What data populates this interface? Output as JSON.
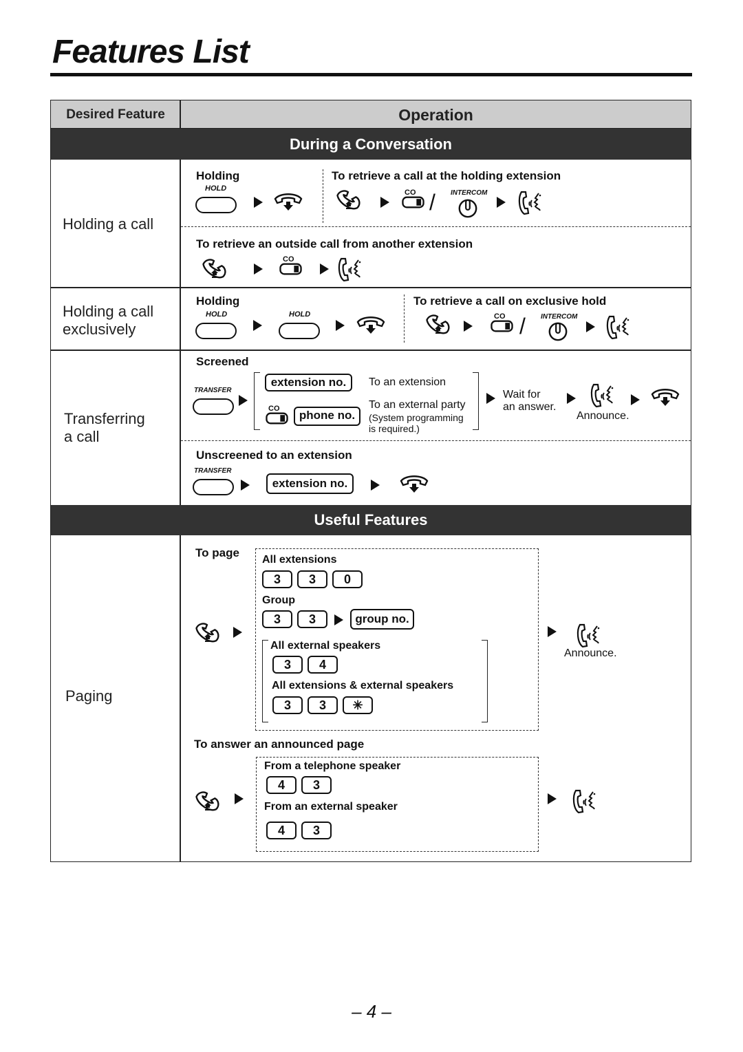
{
  "page_title": "Features List",
  "page_number": "– 4 –",
  "table": {
    "col_feature": "Desired Feature",
    "col_operation": "Operation"
  },
  "sections": {
    "conversation": "During a Conversation",
    "useful": "Useful Features"
  },
  "holding": {
    "feature": "Holding a call",
    "holding_label": "Holding",
    "hold_cap": "HOLD",
    "retrieve_holding_label": "To retrieve a call at the holding extension",
    "retrieve_outside_label": "To retrieve an outside call from another extension",
    "co_cap": "CO",
    "intercom_cap": "INTERCOM",
    "slash": "/"
  },
  "exclusive": {
    "feature_line1": "Holding a call",
    "feature_line2": "exclusively",
    "holding_label": "Holding",
    "hold_cap": "HOLD",
    "retrieve_label": "To retrieve a call on exclusive hold",
    "co_cap": "CO",
    "intercom_cap": "INTERCOM",
    "slash": "/"
  },
  "transfer": {
    "feature_line1": "Transferring",
    "feature_line2": "a call",
    "screened_label": "Screened",
    "transfer_cap": "TRANSFER",
    "extension_key": "extension no.",
    "to_extension": "To an extension",
    "co_cap": "CO",
    "phone_key": "phone no.",
    "to_external": "To an external party",
    "sys_prog_1": "(System programming",
    "sys_prog_2": "is required.)",
    "wait_1": "Wait for",
    "wait_2": "an answer.",
    "announce": "Announce.",
    "unscreened_label": "Unscreened to an extension"
  },
  "paging": {
    "feature": "Paging",
    "to_page_label": "To page",
    "all_ext_label": "All extensions",
    "all_ext_keys": [
      "3",
      "3",
      "0"
    ],
    "group_label": "Group",
    "group_keys": [
      "3",
      "3"
    ],
    "group_no_key": "group no.",
    "ext_speakers_label": "All external speakers",
    "ext_speakers_keys": [
      "3",
      "4"
    ],
    "all_both_label": "All extensions & external speakers",
    "all_both_keys": [
      "3",
      "3",
      "✳"
    ],
    "announce": "Announce.",
    "answer_label": "To answer an announced page",
    "from_tel_label": "From a telephone speaker",
    "from_tel_keys": [
      "4",
      "3"
    ],
    "from_ext_label": "From an external speaker",
    "from_ext_keys": [
      "4",
      "3"
    ]
  }
}
